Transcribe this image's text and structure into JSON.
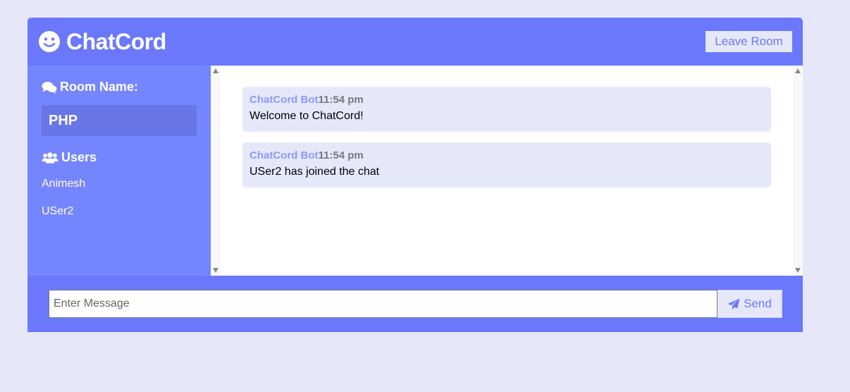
{
  "header": {
    "app_name": "ChatCord",
    "logo_icon": "smile-icon",
    "leave_label": "Leave Room"
  },
  "sidebar": {
    "room_heading": "Room Name:",
    "room_icon": "comments-icon",
    "room_name": "PHP",
    "users_heading": "Users",
    "users_icon": "users-icon",
    "users": [
      "Animesh",
      "USer2"
    ]
  },
  "messages": [
    {
      "user": "ChatCord Bot",
      "time": "11:54 pm",
      "text": "Welcome to ChatCord!"
    },
    {
      "user": "ChatCord Bot",
      "time": "11:54 pm",
      "text": "USer2 has joined the chat"
    }
  ],
  "footer": {
    "input_placeholder": "Enter Message",
    "send_label": "Send",
    "send_icon": "paper-plane-icon"
  },
  "colors": {
    "primary": "#6b78fc",
    "sidebar": "#7585fe",
    "room_box": "#6a76e6",
    "light": "#e6e8fa",
    "bot_name": "#8c98fc"
  }
}
